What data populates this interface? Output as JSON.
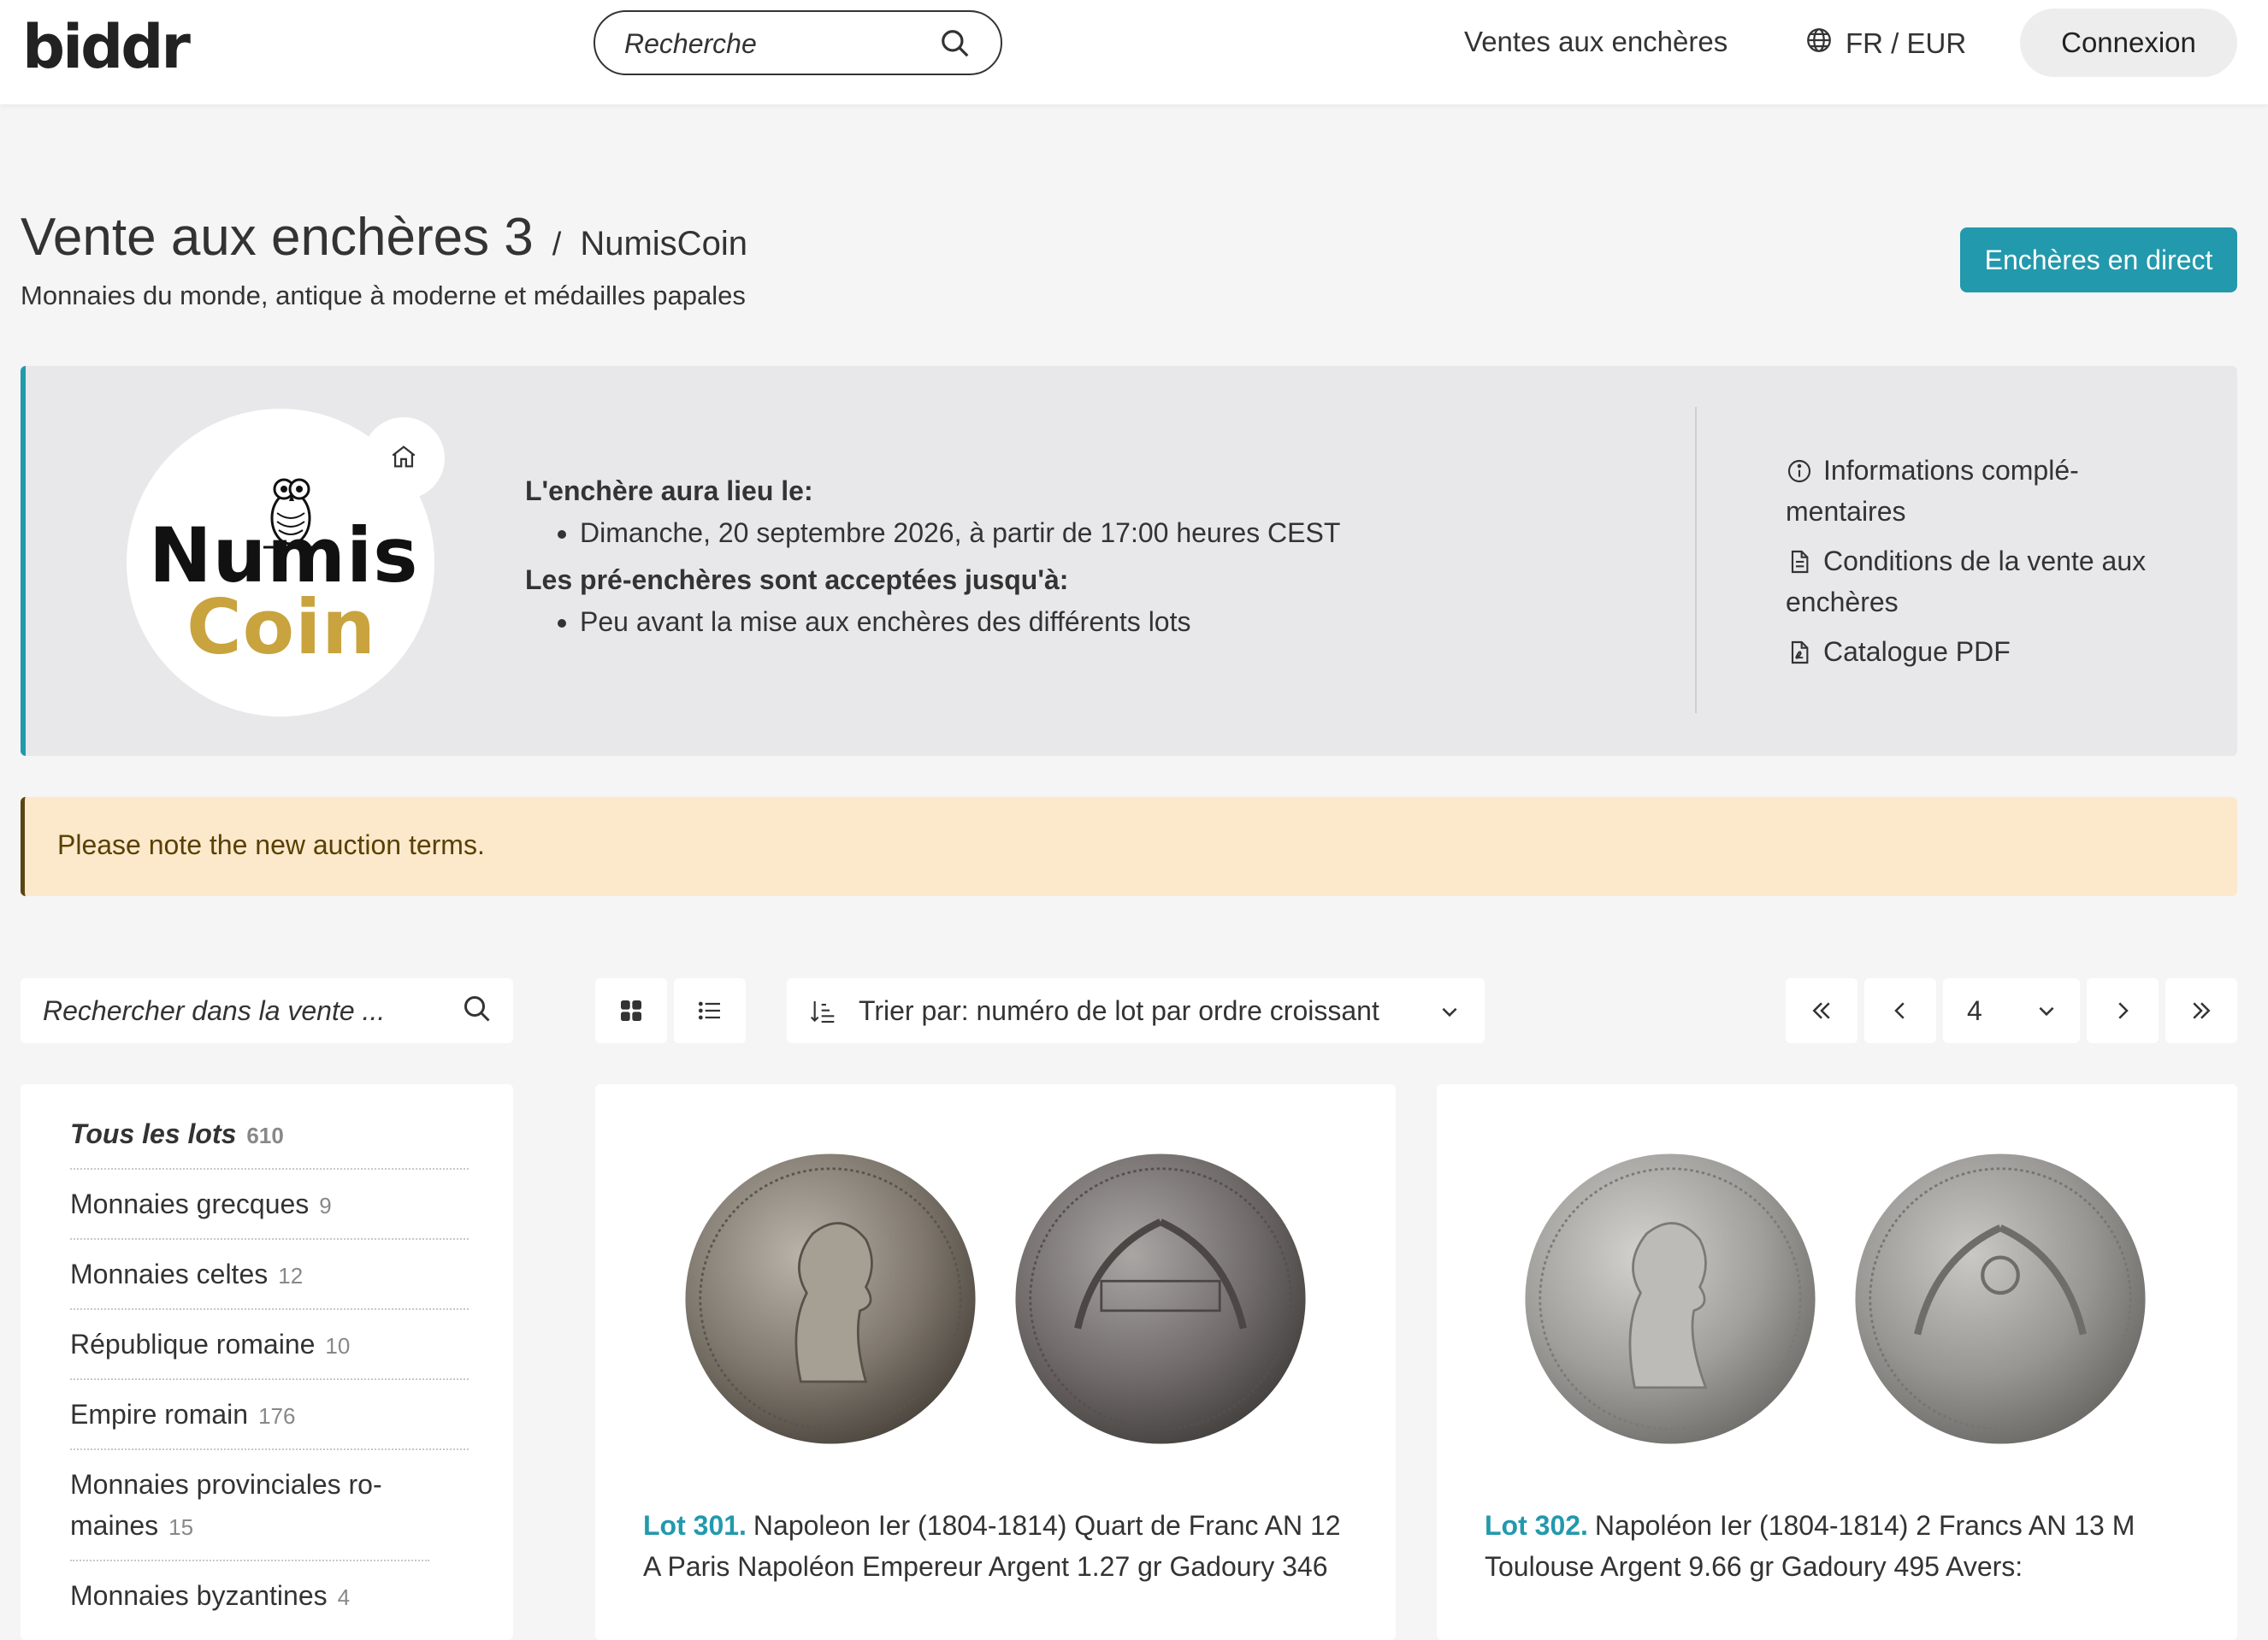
{
  "header": {
    "logo": "biddr",
    "search_placeholder": "Recherche",
    "nav_auctions": "Ventes aux enchères",
    "lang_currency": "FR / EUR",
    "login": "Connexion"
  },
  "auction": {
    "title": "Vente aux enchères 3",
    "separator": "/",
    "seller": "NumisCoin",
    "subtitle": "Monnaies du monde, antique à moderne et médailles papales",
    "live_button": "Enchères en direct"
  },
  "info": {
    "seller_logo": {
      "line1": "Numis",
      "line2": "Coin"
    },
    "date_label": "L'enchère aura lieu le:",
    "date_value": "Dimanche, 20 septembre 2026, à partir de 17:00 heures CEST",
    "prebid_label": "Les pré-enchères sont acceptées jusqu'à:",
    "prebid_value": "Peu avant la mise aux enchères des différents lots",
    "links": [
      {
        "label": "Informations complé-mentaires",
        "icon": "info-icon"
      },
      {
        "label": "Conditions de la vente aux enchères",
        "icon": "document-icon"
      },
      {
        "label": "Catalogue PDF",
        "icon": "pdf-icon"
      }
    ]
  },
  "notice": "Please note the new auction terms.",
  "toolbar": {
    "sale_search_placeholder": "Rechercher dans la vente ...",
    "sort_label": "Trier par: numéro de lot par ordre croissant",
    "current_page": "4"
  },
  "categories": [
    {
      "name": "Tous les lots",
      "count": "610"
    },
    {
      "name": "Monnaies grecques",
      "count": "9"
    },
    {
      "name": "Monnaies celtes",
      "count": "12"
    },
    {
      "name": "République romaine",
      "count": "10"
    },
    {
      "name": "Empire romain",
      "count": "176"
    },
    {
      "name": "Monnaies provinciales ro-maines",
      "count": "15"
    },
    {
      "name": "Monnaies byzantines",
      "count": "4"
    }
  ],
  "lots": [
    {
      "number": "Lot 301.",
      "description": "Napoleon Ier (1804-1814) Quart de Franc AN 12 A Paris Napoléon Empereur Argent 1.27 gr Gadoury 346"
    },
    {
      "number": "Lot 302.",
      "description": "Napoléon Ier (1804-1814) 2 Francs AN 13 M Toulouse Argent 9.66 gr Gadoury 495 Avers:"
    }
  ],
  "colors": {
    "accent": "#2399ad",
    "notice_bg": "#fce9cc",
    "logo_gold": "#c9a33e"
  }
}
